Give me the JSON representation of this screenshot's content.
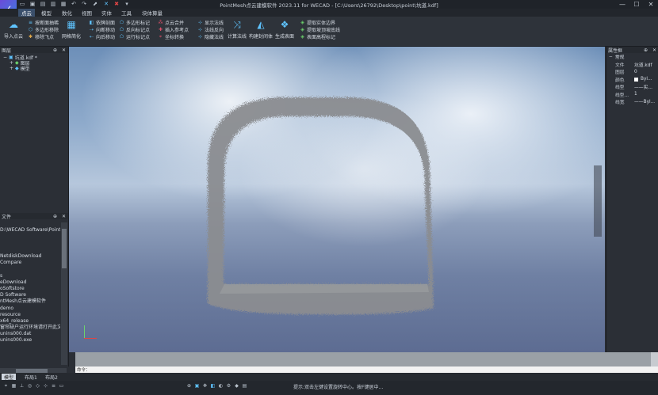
{
  "window": {
    "title": "PointMesh点云建模软件 2023.11 for WECAD - [C:\\Users\\26792\\Desktop\\point\\坑道.kdf]",
    "min": "—",
    "max": "☐",
    "close": "✕"
  },
  "menu_tabs": [
    "点云",
    "模型",
    "数化",
    "视图",
    "实体",
    "工具",
    "块体算量"
  ],
  "ribbon": {
    "import_cloud": "导入点云",
    "group1": [
      "按断面抽稀",
      "多边形移除",
      "移除飞点"
    ],
    "mesh_simplify": "网格简化",
    "group2": [
      "依牌剖面",
      "向断移动",
      "向后移动"
    ],
    "group3": [
      "多边形标记",
      "反向标记点",
      "运行标记点"
    ],
    "group4": [
      "点云合并",
      "插入参考点",
      "坐标转换"
    ],
    "group5": [
      "显示法线",
      "法线反向",
      "隐藏法线"
    ],
    "calc_normal": "计算法线",
    "build_surface": "构建封闭体",
    "gen_surface": "生成表面",
    "group6": [
      "提取实体边界",
      "提取坡顶坡底线",
      "表面高程标记"
    ]
  },
  "layers_panel": {
    "title": "图层",
    "root": "坑道.kdf *",
    "children": [
      "图层",
      "模型"
    ]
  },
  "files_panel": {
    "title": "文件",
    "path": "D:\\WECAD Software\\PointM",
    "items": [
      "NetdiskDownload",
      "Compare",
      "",
      "s",
      "eDownload",
      "oSoftstore",
      "D Software",
      "ntMesh点云建模软件",
      "demo",
      "resource",
      "x64_release",
      "窗帘缺户运行环境请打开此文",
      "unins000.dat",
      "unins000.exe"
    ]
  },
  "properties_panel": {
    "title": "属性框",
    "section": "常规",
    "rows": [
      {
        "key": "文件",
        "value": "坑道.kdf"
      },
      {
        "key": "图层",
        "value": "0"
      },
      {
        "key": "颜色",
        "value": "Byl..."
      },
      {
        "key": "线型",
        "value": "——实..."
      },
      {
        "key": "线型...",
        "value": "1"
      },
      {
        "key": "线宽",
        "value": "——Byl..."
      }
    ]
  },
  "command": {
    "prompt": "命令：",
    "line": "命令："
  },
  "layout_tabs": [
    "模型",
    "布局1",
    "布局2"
  ],
  "status": {
    "hint": "提示:双击左键设置旋转中心。按F键居中…"
  },
  "colors": {
    "accent": "#3a4f6b",
    "logo": "#5b5fe0"
  }
}
